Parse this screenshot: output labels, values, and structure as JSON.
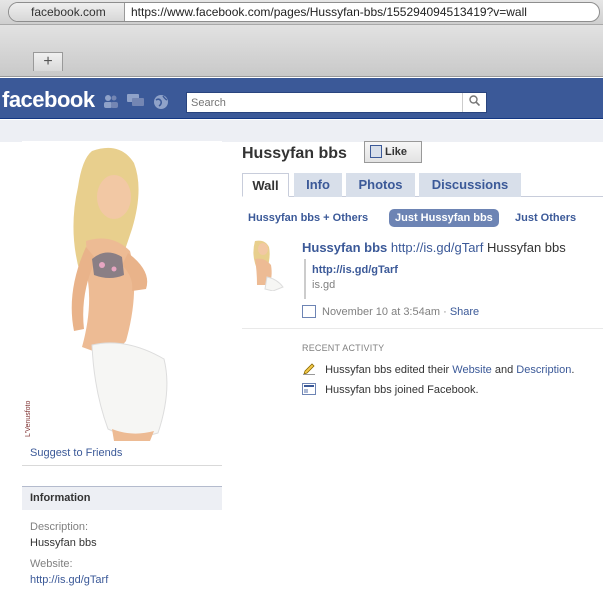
{
  "browser": {
    "domain_label": "facebook.com",
    "url": "https://www.facebook.com/pages/Hussyfan-bbs/155294094513419?v=wall",
    "new_tab_label": "+"
  },
  "header": {
    "logo": "facebook",
    "search_placeholder": "Search"
  },
  "page": {
    "title": "Hussyfan bbs",
    "like_label": "Like",
    "photo_watermark": "L'Venusfoto"
  },
  "tabs": [
    {
      "label": "Wall"
    },
    {
      "label": "Info"
    },
    {
      "label": "Photos"
    },
    {
      "label": "Discussions"
    }
  ],
  "filters": [
    {
      "label": "Hussyfan bbs + Others"
    },
    {
      "label": "Just Hussyfan bbs"
    },
    {
      "label": "Just Others"
    }
  ],
  "post": {
    "author": "Hussyfan bbs",
    "link": "http://is.gd/gTarf",
    "text": "Hussyfan bbs",
    "attachment_title": "http://is.gd/gTarf",
    "attachment_sub": "is.gd",
    "time": "November 10 at 3:54am",
    "separator": "·",
    "share": "Share"
  },
  "recent": {
    "heading": "RECENT ACTIVITY",
    "row1": {
      "pre": "Hussyfan bbs edited their",
      "website": "Website",
      "and": "and",
      "description": "Description",
      "end": "."
    },
    "row2": "Hussyfan bbs joined Facebook."
  },
  "sidebar": {
    "suggest": "Suggest to Friends",
    "info_heading": "Information",
    "desc_label": "Description:",
    "desc_value": "Hussyfan bbs",
    "website_label": "Website:",
    "website_value": "http://is.gd/gTarf"
  },
  "colors": {
    "fb_blue": "#3b5998",
    "tab_bg": "#d8dfea",
    "filter_selected": "#6d84b4"
  }
}
